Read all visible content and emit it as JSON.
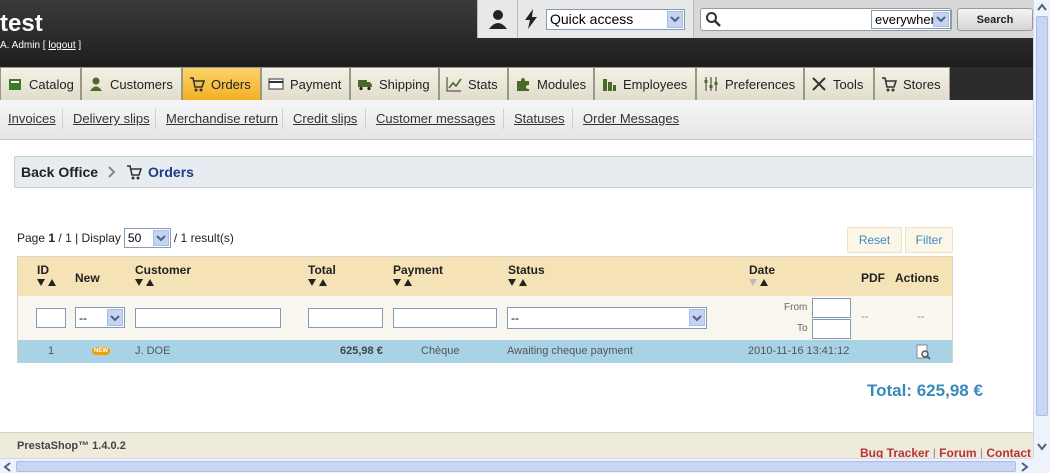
{
  "header": {
    "shop_name": "test",
    "admin_name": "A. Admin [",
    "logout_label": "logout",
    "admin_suffix": "]",
    "quick_access_label": "Quick access",
    "search_scope": "everywhere",
    "search_button": "Search"
  },
  "tabs": [
    {
      "label": "Catalog",
      "icon": "catalog-icon"
    },
    {
      "label": "Customers",
      "icon": "customer-icon"
    },
    {
      "label": "Orders",
      "icon": "cart-icon",
      "active": true
    },
    {
      "label": "Payment",
      "icon": "card-icon"
    },
    {
      "label": "Shipping",
      "icon": "truck-icon"
    },
    {
      "label": "Stats",
      "icon": "stats-icon"
    },
    {
      "label": "Modules",
      "icon": "puzzle-icon"
    },
    {
      "label": "Employees",
      "icon": "employees-icon"
    },
    {
      "label": "Preferences",
      "icon": "sliders-icon"
    },
    {
      "label": "Tools",
      "icon": "tools-icon"
    },
    {
      "label": "Stores",
      "icon": "cart-icon"
    }
  ],
  "subtabs": [
    "Invoices",
    "Delivery slips",
    "Merchandise return",
    "Credit slips",
    "Customer messages",
    "Statuses",
    "Order Messages"
  ],
  "breadcrumb": {
    "root": "Back Office",
    "current": "Orders"
  },
  "paging": {
    "page_prefix": "Page",
    "page_current": "1",
    "page_total": "/ 1 | Display",
    "per_page": "50",
    "results": "/ 1 result(s)"
  },
  "buttons": {
    "reset": "Reset",
    "filter": "Filter"
  },
  "table": {
    "columns": {
      "id": "ID",
      "new": "New",
      "customer": "Customer",
      "total": "Total",
      "payment": "Payment",
      "status": "Status",
      "date": "Date",
      "pdf": "PDF",
      "actions": "Actions"
    },
    "filters": {
      "new_select": "--",
      "status_select": "--",
      "date_from": "From",
      "date_to": "To",
      "pdf": "--",
      "actions": "--"
    },
    "rows": [
      {
        "id": "1",
        "new_badge": "NEW",
        "customer": "J. DOE",
        "total": "625,98 €",
        "payment": "Chèque",
        "status": "Awaiting cheque payment",
        "date": "2010-11-16 13:41:12"
      }
    ]
  },
  "grand_total": "Total: 625,98 €",
  "footer": {
    "version": "PrestaShop™ 1.4.0.2",
    "links": [
      "Bug Tracker",
      "Forum",
      "Contact"
    ],
    "separator": "|"
  },
  "colors": {
    "active_tab": "#f3b023",
    "row_highlight": "#a8d3e6",
    "table_header": "#f5e2b7",
    "total_text": "#3a8ab9"
  }
}
